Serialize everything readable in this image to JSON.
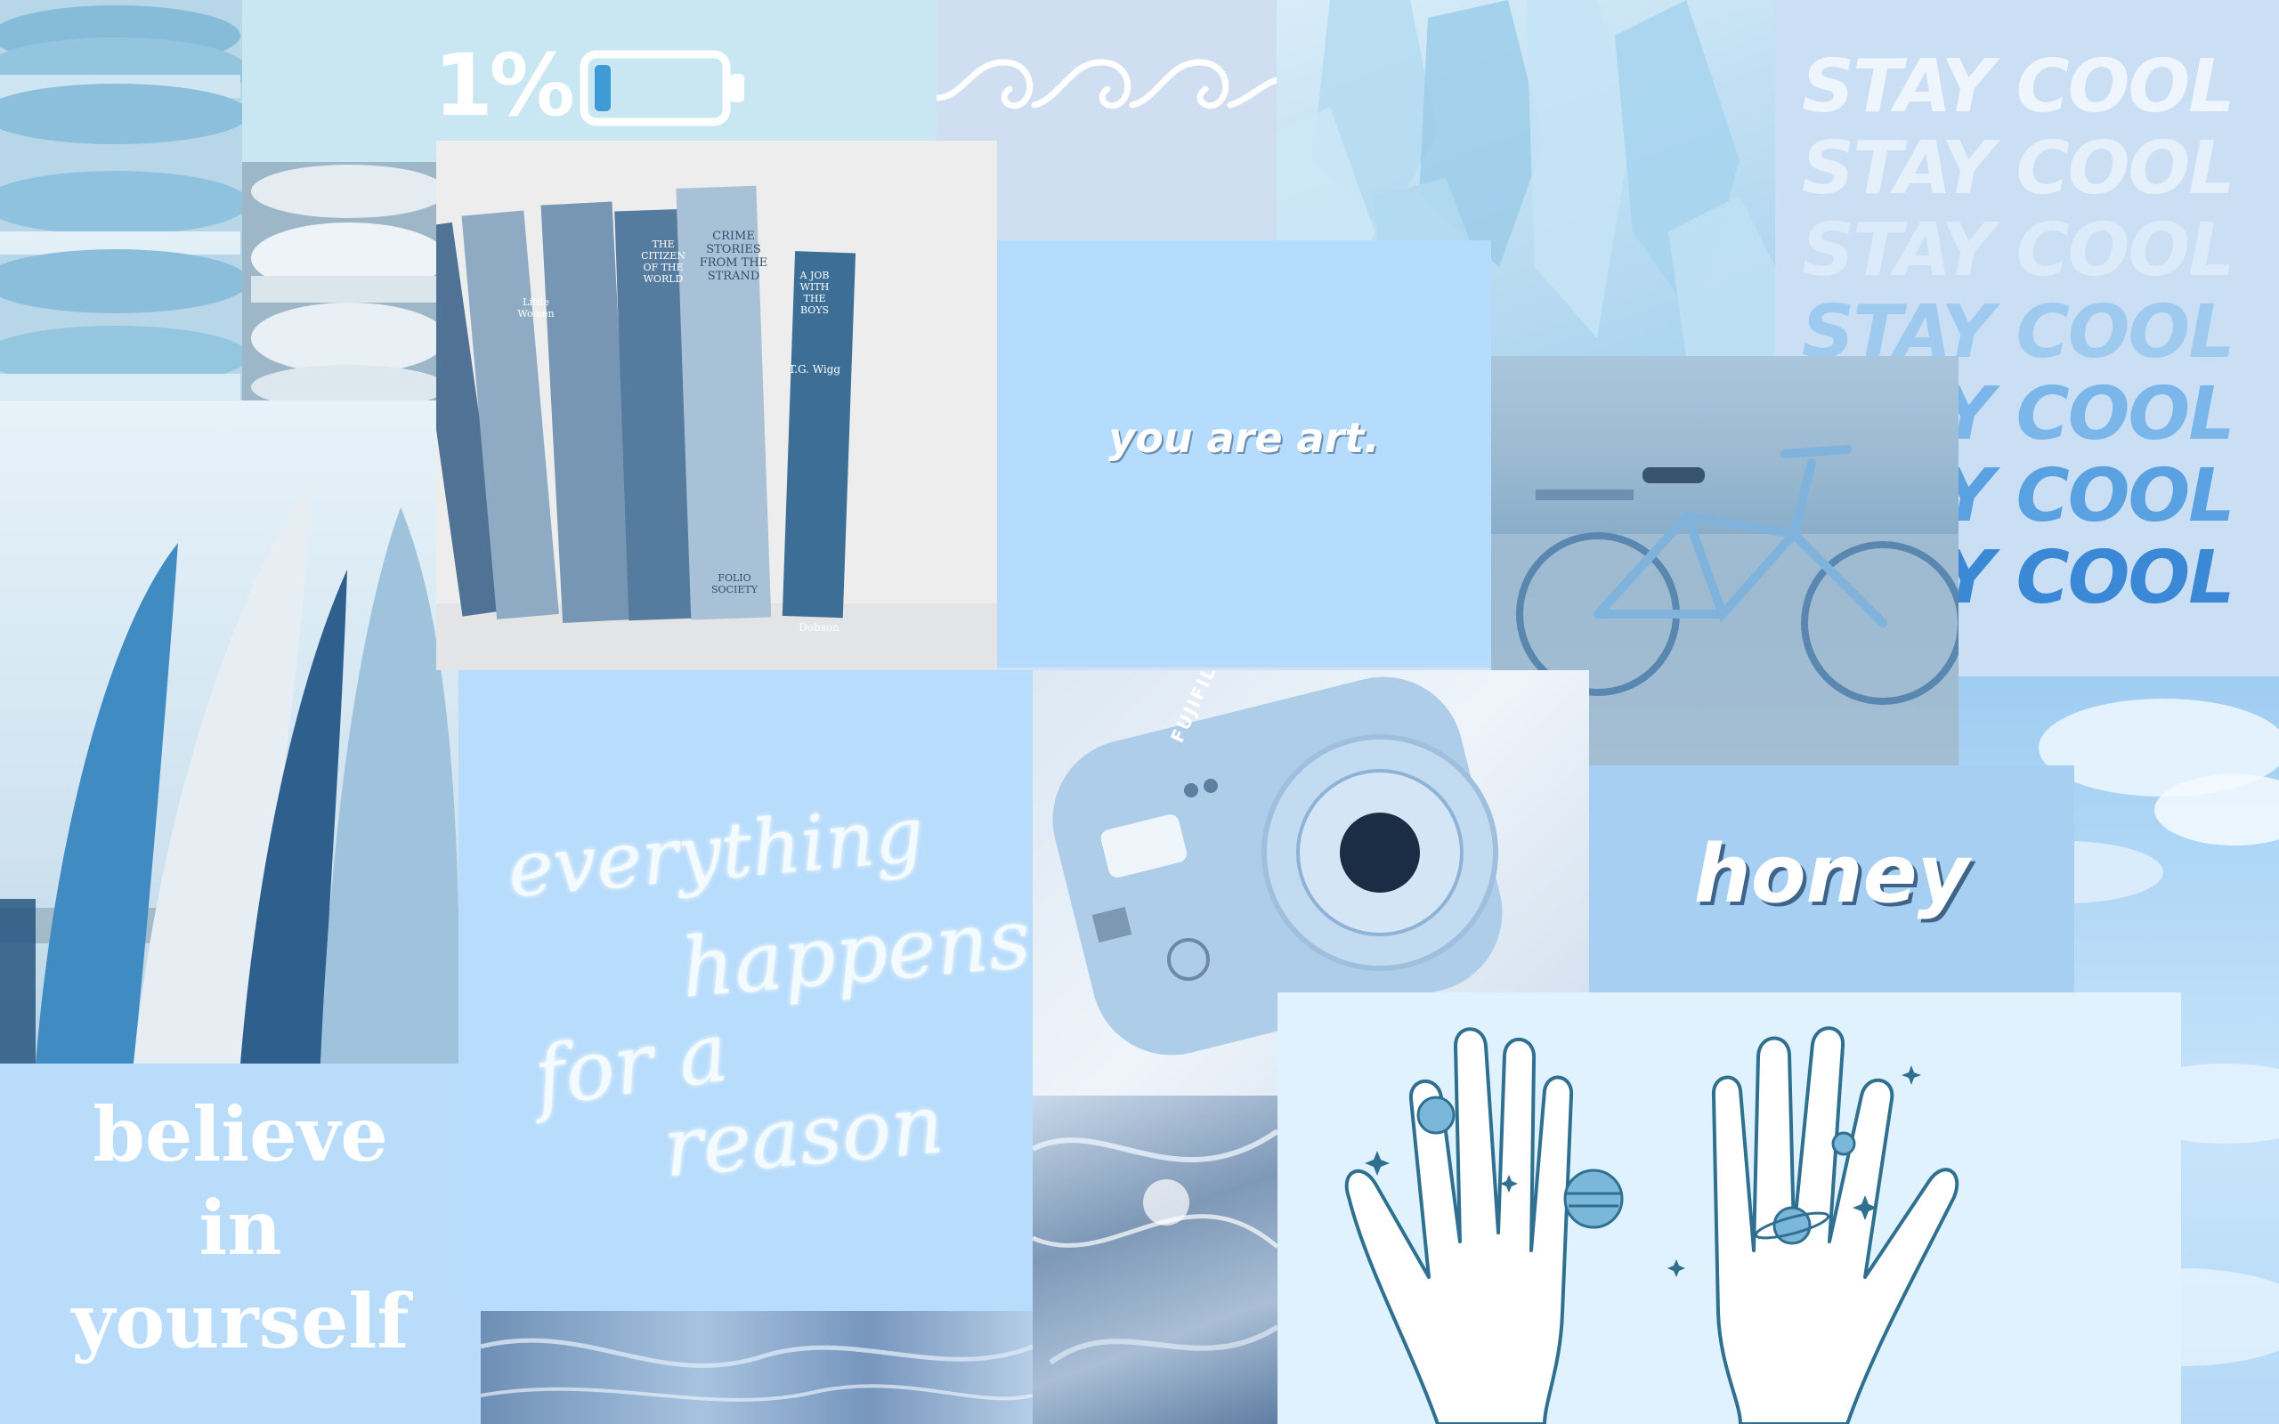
{
  "battery": {
    "percent_text": "1%",
    "level": 0.01
  },
  "quote_art": "you are art.",
  "quote_honey": "honey",
  "quote_everything": {
    "line1": "everything",
    "line2": "happens",
    "line3": "for a",
    "line4": "reason"
  },
  "quote_believe": {
    "line1": "believe",
    "line2": "in",
    "line3": "yourself"
  },
  "stay_cool": [
    "STAY COOL",
    "STAY COOL",
    "STAY COOL",
    "STAY COOL",
    "STAY COOL",
    "STAY COOL",
    "STAY COOL"
  ],
  "books": {
    "spine1": "Little Women",
    "spine2": "THE CITIZEN OF THE WORLD",
    "spine3": "CRIME STORIES FROM THE STRAND",
    "spine3b": "FOLIO SOCIETY",
    "spine4": "A JOB WITH THE BOYS",
    "spine4b": "T.G. Wigg",
    "spine4c": "Dobson"
  },
  "camera_brand": "FUJIFILM",
  "colors": {
    "base": "#cfe3f6",
    "powder": "#b7dcfb",
    "sky": "#a8cff3",
    "deep": "#3f88d0",
    "white": "#ffffff"
  }
}
